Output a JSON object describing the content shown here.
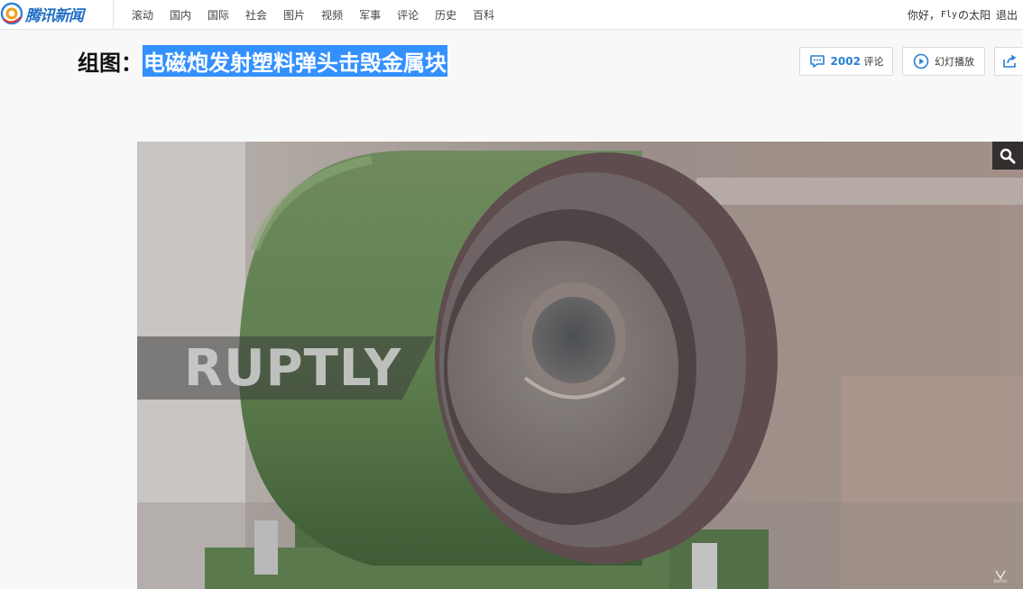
{
  "header": {
    "logo_text": "腾讯新闻",
    "logo_icon": "qq-news-logo",
    "nav": [
      "滚动",
      "国内",
      "国际",
      "社会",
      "图片",
      "视频",
      "军事",
      "评论",
      "历史",
      "百科"
    ],
    "greeting": "你好，",
    "username": "Fly",
    "username_suffix": "の太阳",
    "logout": "退出"
  },
  "article": {
    "title_prefix": "组图：",
    "title_main": "电磁炮发射塑料弹头击毁金属块",
    "comment_count": "2002",
    "comment_label": "评论",
    "slideshow_label": "幻灯播放"
  },
  "photo": {
    "watermark": "RUPTLY",
    "corner_mark": "RUPTLY",
    "zoom_icon": "search-icon"
  },
  "colors": {
    "brand": "#1f6fc5",
    "highlight": "#3390ff",
    "accent": "#2a7fd3"
  }
}
